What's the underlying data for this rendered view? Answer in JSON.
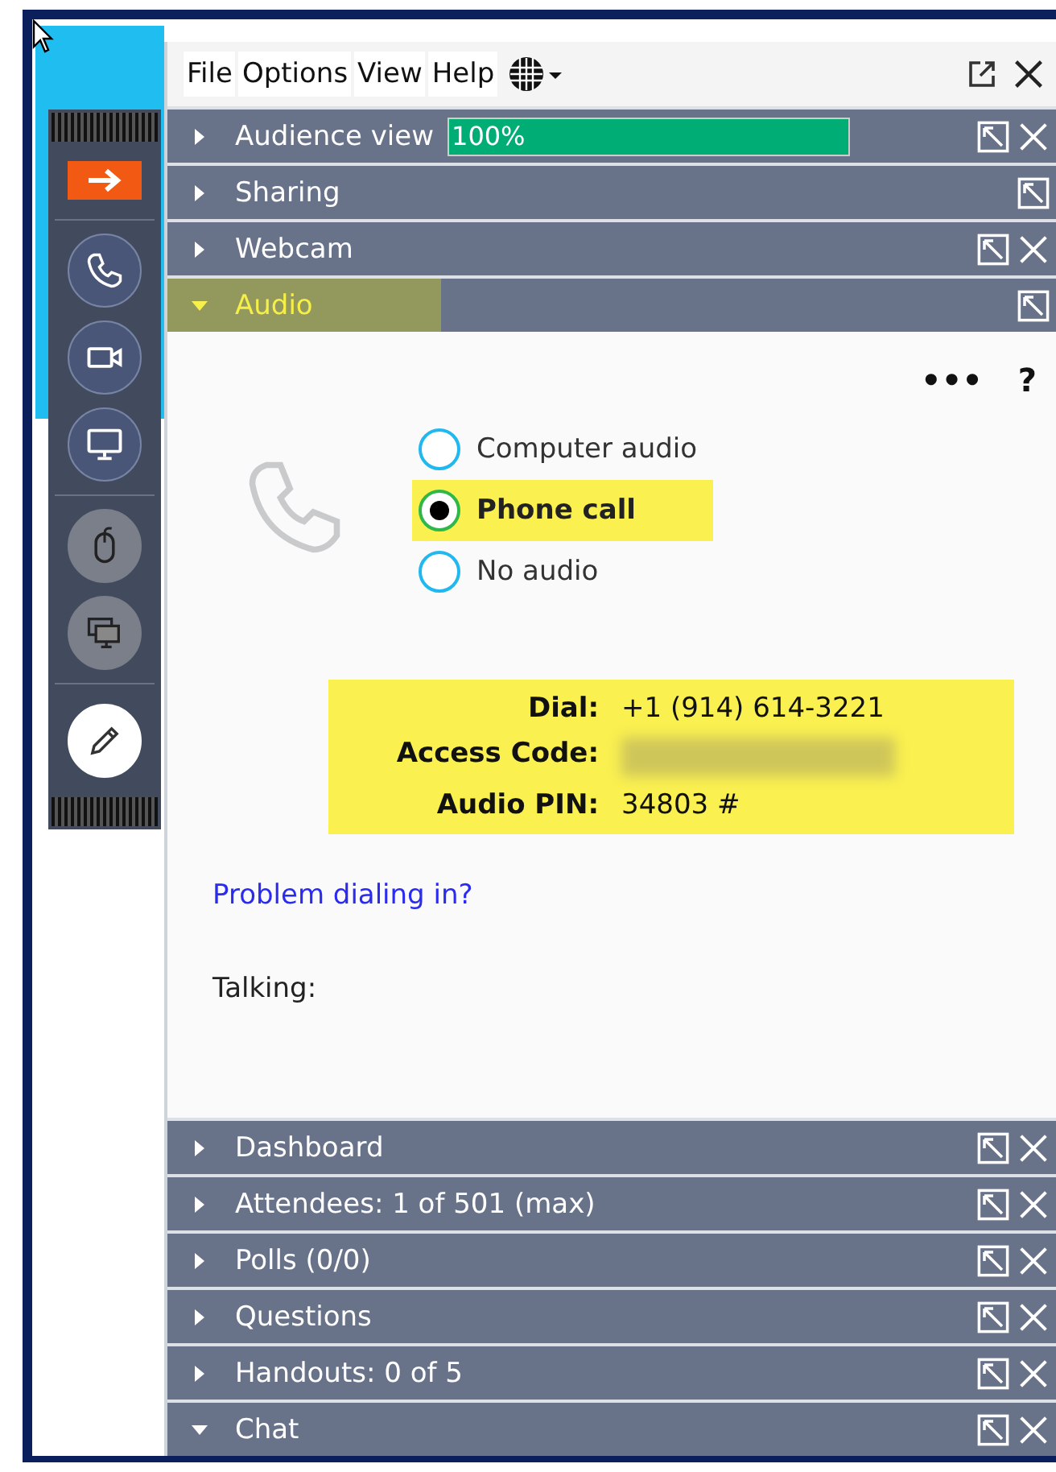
{
  "menu": [
    "File",
    "Options",
    "View",
    "Help"
  ],
  "toolbar": [
    {
      "kind": "arrow",
      "disabled": false
    },
    {
      "kind": "phone",
      "disabled": false
    },
    {
      "kind": "camera",
      "disabled": false
    },
    {
      "kind": "screen",
      "disabled": false
    },
    {
      "kind": "mouse",
      "disabled": true
    },
    {
      "kind": "screens",
      "disabled": true
    },
    {
      "kind": "pen",
      "disabled": false
    }
  ],
  "top_panels": [
    {
      "label": "Audience view",
      "expanded": false,
      "closable": true,
      "highlighted": false,
      "meter": {
        "reading": "100%",
        "level": 1.0
      }
    },
    {
      "label": "Sharing",
      "expanded": false,
      "closable": false,
      "highlighted": false
    },
    {
      "label": "Webcam",
      "expanded": false,
      "closable": true,
      "highlighted": false
    },
    {
      "label": "Audio",
      "expanded": true,
      "closable": false,
      "highlighted": true
    }
  ],
  "audio": {
    "more": "•••",
    "help": "?",
    "options": [
      {
        "label": "Computer audio",
        "selected": false,
        "highlighted": false
      },
      {
        "label": "Phone call",
        "selected": true,
        "highlighted": true
      },
      {
        "label": "No audio",
        "selected": false,
        "highlighted": false
      }
    ],
    "details": {
      "highlighted": true,
      "rows": [
        {
          "label": "Dial:",
          "value": "+1 (914) 614-3221"
        },
        {
          "label": "Access Code:",
          "redacted": true
        },
        {
          "label": "Audio PIN:",
          "value": "34803 #"
        }
      ]
    },
    "link": "Problem dialing in?",
    "talking": "Talking:"
  },
  "bottom_panels": [
    {
      "label": "Dashboard",
      "expanded": false,
      "closable": true,
      "highlighted": false
    },
    {
      "label": "Attendees:  1 of 501 (max)",
      "expanded": false,
      "closable": true,
      "highlighted": false
    },
    {
      "label": "Polls (0/0)",
      "expanded": false,
      "closable": true,
      "highlighted": false
    },
    {
      "label": "Questions",
      "expanded": false,
      "closable": true,
      "highlighted": false
    },
    {
      "label": "Handouts: 0 of 5",
      "expanded": false,
      "closable": true,
      "highlighted": false
    },
    {
      "label": "Chat",
      "expanded": true,
      "closable": true,
      "highlighted": false
    }
  ]
}
